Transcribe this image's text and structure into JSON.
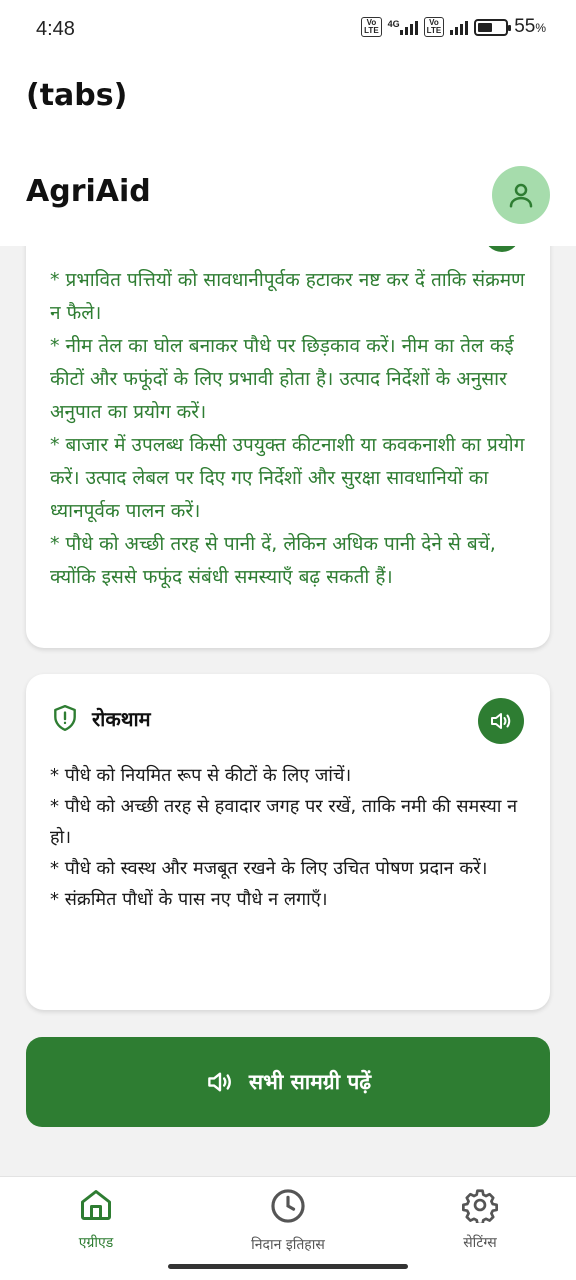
{
  "status": {
    "time": "4:48",
    "volte1": "Vo LTE",
    "net": "4G",
    "volte2": "Vo LTE",
    "battery_pct": "55",
    "battery_level": 0.55,
    "percent_sign": "%"
  },
  "header": {
    "tabs_title": "(tabs)",
    "app_title": "AgriAid",
    "avatar_icon": "person-icon"
  },
  "treatment": {
    "lines": [
      "* प्रभावित पत्तियों को सावधानीपूर्वक हटाकर नष्ट कर दें ताकि संक्रमण न फैले।",
      "* नीम तेल का घोल बनाकर पौधे पर छिड़काव करें। नीम का तेल कई कीटों और फफूंदों के लिए प्रभावी होता है। उत्पाद निर्देशों के अनुसार अनुपात का प्रयोग करें।",
      "* बाजार में उपलब्ध किसी उपयुक्त कीटनाशी या कवकनाशी का प्रयोग करें। उत्पाद लेबल पर दिए गए निर्देशों और सुरक्षा सावधानियों का ध्यानपूर्वक पालन करें।",
      "* पौधे को अच्छी तरह से पानी दें, लेकिन अधिक पानी देने से बचें, क्योंकि इससे फफूंद संबंधी समस्याएँ बढ़ सकती हैं।"
    ]
  },
  "prevention": {
    "title": "रोकथाम",
    "icon": "shield-alert-icon",
    "speak_icon": "speaker-icon",
    "lines": [
      "* पौधे को नियमित रूप से कीटों के लिए जांचें।",
      "* पौधे को अच्छी तरह से हवादार जगह पर रखें, ताकि नमी की समस्या न हो।",
      "* पौधे को स्वस्थ और मजबूत रखने के लिए उचित पोषण प्रदान करें।",
      "* संक्रमित पौधों के पास नए पौधे न लगाएँ।"
    ]
  },
  "read_all": {
    "label": "सभी सामग्री पढ़ें",
    "icon": "speaker-icon"
  },
  "nav": {
    "items": [
      {
        "label": "एग्रीएड",
        "icon": "home-icon",
        "active": true
      },
      {
        "label": "निदान इतिहास",
        "icon": "clock-icon",
        "active": false
      },
      {
        "label": "सेटिंग्स",
        "icon": "gear-icon",
        "active": false
      }
    ]
  },
  "colors": {
    "primary": "#2e7d32",
    "avatar_bg": "#a6dcac",
    "background": "#f2f2f2"
  }
}
